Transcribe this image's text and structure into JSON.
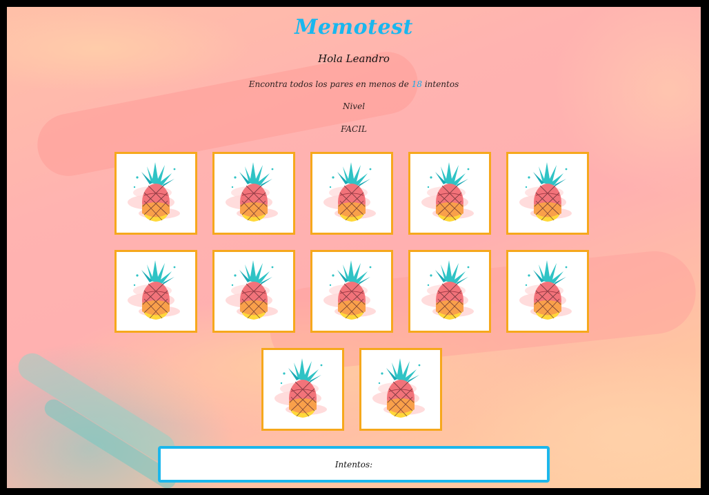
{
  "game": {
    "title": "Memotest",
    "greeting": "Hola Leandro",
    "instructions_prefix": "Encontra todos los pares en menos de",
    "max_attempts": "18",
    "instructions_suffix": "intentos",
    "level_label": "Nivel",
    "level_value": "FACIL",
    "attempts_label": "Intentos:",
    "card_back_icon": "pineapple-icon"
  },
  "colors": {
    "title": "#19b7ee",
    "card_border": "#f6a81c",
    "attempts_border": "#1bb7ec"
  },
  "cards": [
    {
      "state": "face-down"
    },
    {
      "state": "face-down"
    },
    {
      "state": "face-down"
    },
    {
      "state": "face-down"
    },
    {
      "state": "face-down"
    },
    {
      "state": "face-down"
    },
    {
      "state": "face-down"
    },
    {
      "state": "face-down"
    },
    {
      "state": "face-down"
    },
    {
      "state": "face-down"
    },
    {
      "state": "face-down"
    },
    {
      "state": "face-down"
    }
  ]
}
